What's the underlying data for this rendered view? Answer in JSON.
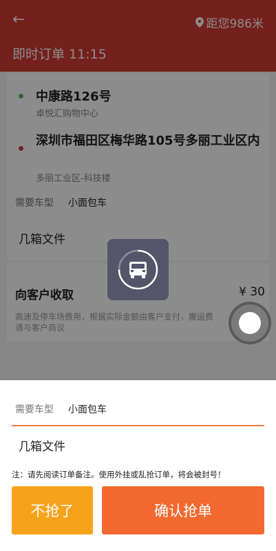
{
  "header": {
    "back_icon": "back-arrow-icon",
    "distance": "距您986米",
    "title": "即时订单 11:15"
  },
  "order": {
    "pickup": {
      "address": "中康路126号",
      "landmark": "卓悦汇购物中心"
    },
    "dropoff": {
      "address": "深圳市福田区梅华路105号多丽工业区内",
      "landmark": "多丽工业区-科技楼"
    },
    "vehicle_label": "需要车型",
    "vehicle_value": "小面包车",
    "cargo": "几箱文件",
    "fee_title": "向客户收取",
    "fee_amount": "¥ 30",
    "fee_note": "高速及停车场费用，根据实际金额由客户支付，搬运费请与客户商议"
  },
  "sheet": {
    "vehicle_label": "需要车型",
    "vehicle_value": "小面包车",
    "cargo": "几箱文件",
    "notice": "注：请先阅读订单备注。使用外挂或乱抢订单，将会被封号！",
    "decline_label": "不抢了",
    "confirm_label": "确认抢单"
  },
  "colors": {
    "header": "#d43b33",
    "pickup_dot": "#5cb85c",
    "dropoff_dot": "#d43b33",
    "accent": "#f07c40",
    "decline_button": "#f7a21b",
    "confirm_button": "#f26a2f"
  }
}
